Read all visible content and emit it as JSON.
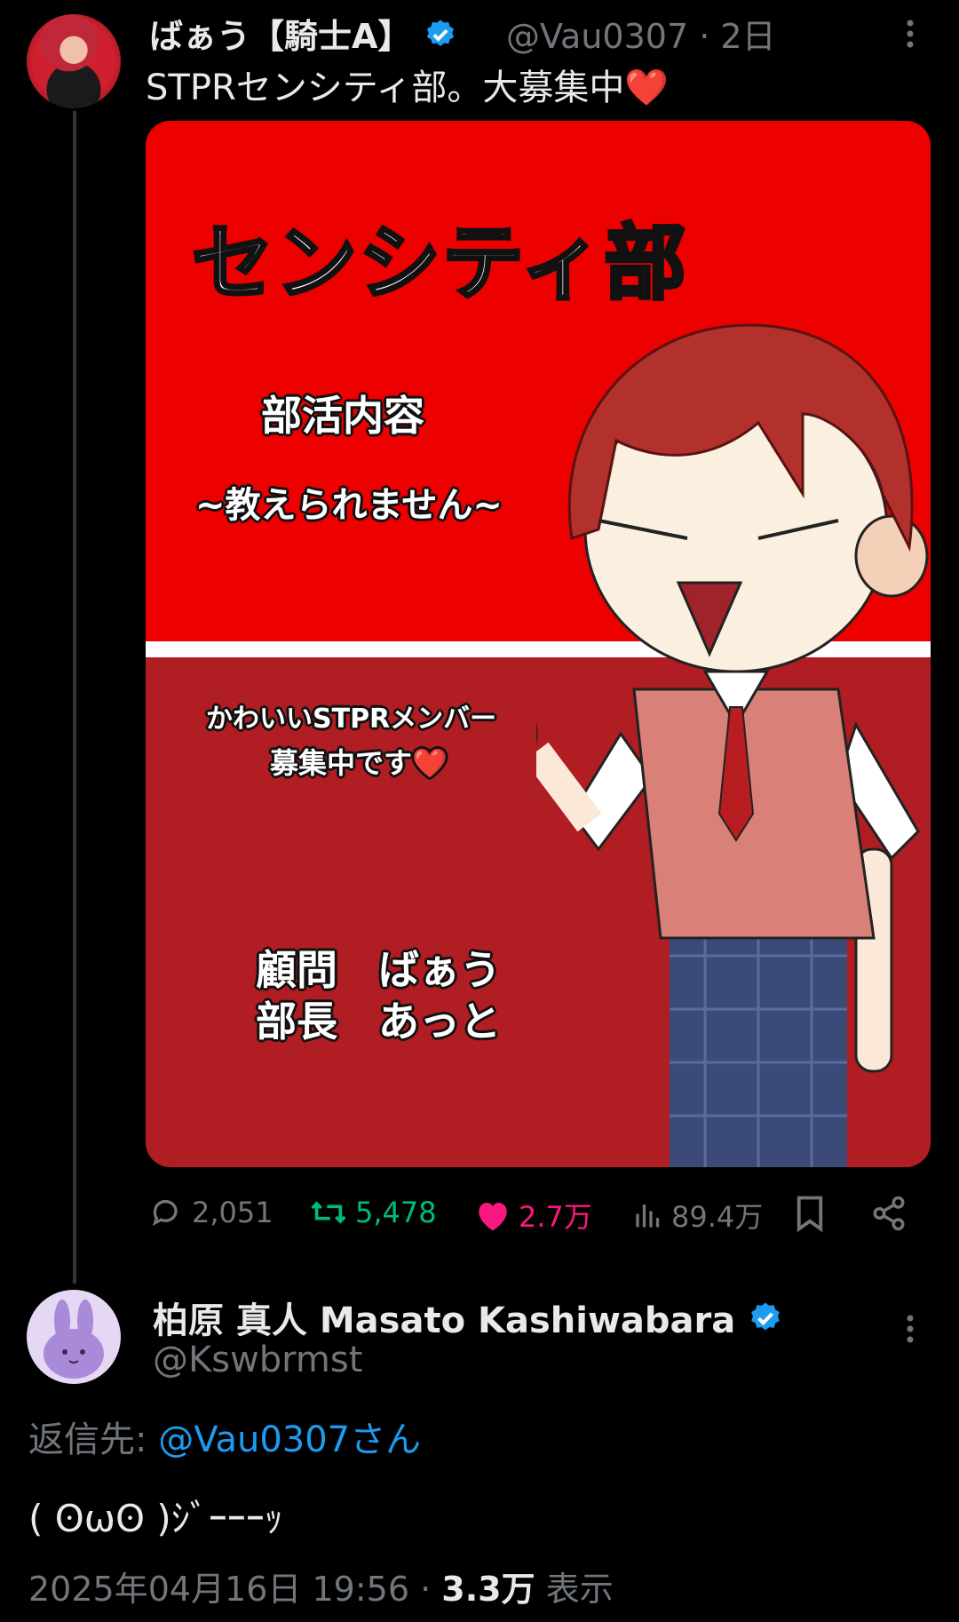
{
  "tweet": {
    "author_name": "ばぁう【騎士A】",
    "handle": "@Vau0307",
    "time": "2日",
    "separator": "·",
    "text": "STPRセンシティ部。大募集中❤️",
    "media": {
      "title": "センシティ部",
      "line1": "部活内容",
      "line2": "~教えられません~",
      "line3": "かわいいSTPRメンバー",
      "line4": "募集中です❤️",
      "line5": "顧問　ばぁう",
      "line6": "部長　あっと"
    },
    "stats": {
      "replies": "2,051",
      "retweets": "5,478",
      "likes": "2.7万",
      "views": "89.4万"
    }
  },
  "reply": {
    "author_name": "柏原 真人 Masato Kashiwabara",
    "handle": "@Kswbrmst",
    "reply_to_label": "返信先: ",
    "reply_to_handle": "@Vau0307さん",
    "text": "( ʘωʘ )ｼﾞｰｰｰｯ",
    "date": "2025年04月16日 19:56",
    "separator": "·",
    "views": "3.3万",
    "views_label": "表示"
  },
  "colors": {
    "background": "#000000",
    "verified": "#1d9bf0",
    "retweet": "#00ba7c",
    "like": "#f91880",
    "muted": "#71767b"
  }
}
